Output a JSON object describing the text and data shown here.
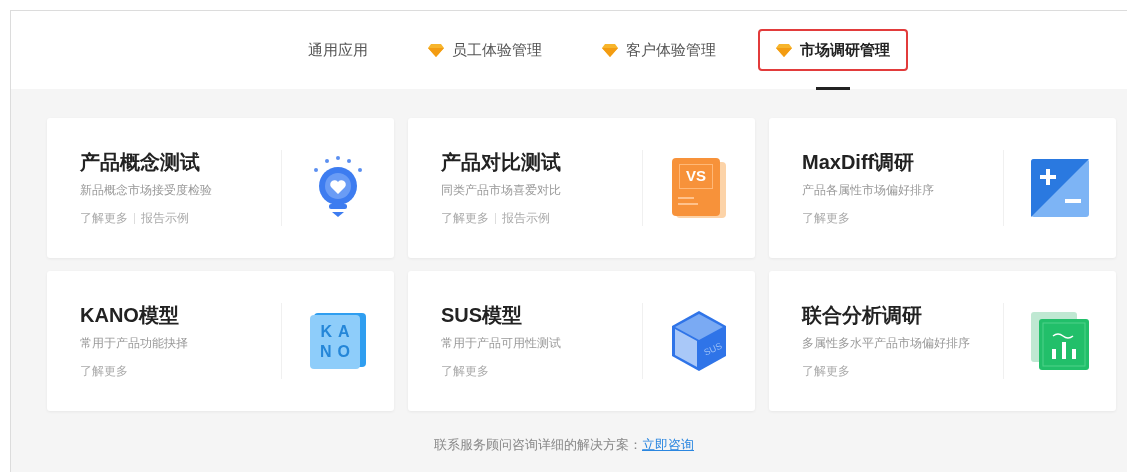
{
  "tabs": [
    {
      "label": "通用应用",
      "premium": false,
      "selected": false
    },
    {
      "label": "员工体验管理",
      "premium": true,
      "selected": false
    },
    {
      "label": "客户体验管理",
      "premium": true,
      "selected": false
    },
    {
      "label": "市场调研管理",
      "premium": true,
      "selected": true
    }
  ],
  "cards": [
    {
      "title": "产品概念测试",
      "description": "新品概念市场接受度检验",
      "links": [
        "了解更多",
        "报告示例"
      ],
      "kind": "bulb"
    },
    {
      "title": "产品对比测试",
      "description": "同类产品市场喜爱对比",
      "links": [
        "了解更多",
        "报告示例"
      ],
      "kind": "versus",
      "icon_text": [
        "VS"
      ]
    },
    {
      "title": "MaxDiff调研",
      "description": "产品各属性市场偏好排序",
      "links": [
        "了解更多"
      ],
      "kind": "plusminus"
    },
    {
      "title": "KANO模型",
      "description": "常用于产品功能抉择",
      "links": [
        "了解更多"
      ],
      "kind": "kano",
      "icon_text": [
        "KA",
        "NO"
      ]
    },
    {
      "title": "SUS模型",
      "description": "常用于产品可用性测试",
      "links": [
        "了解更多"
      ],
      "kind": "cube",
      "icon_text": [
        "SUS"
      ]
    },
    {
      "title": "联合分析调研",
      "description": "多属性多水平产品市场偏好排序",
      "links": [
        "了解更多"
      ],
      "kind": "chart"
    }
  ],
  "footer": {
    "text": "联系服务顾问咨询详细的解决方案：",
    "link": "立即咨询"
  }
}
